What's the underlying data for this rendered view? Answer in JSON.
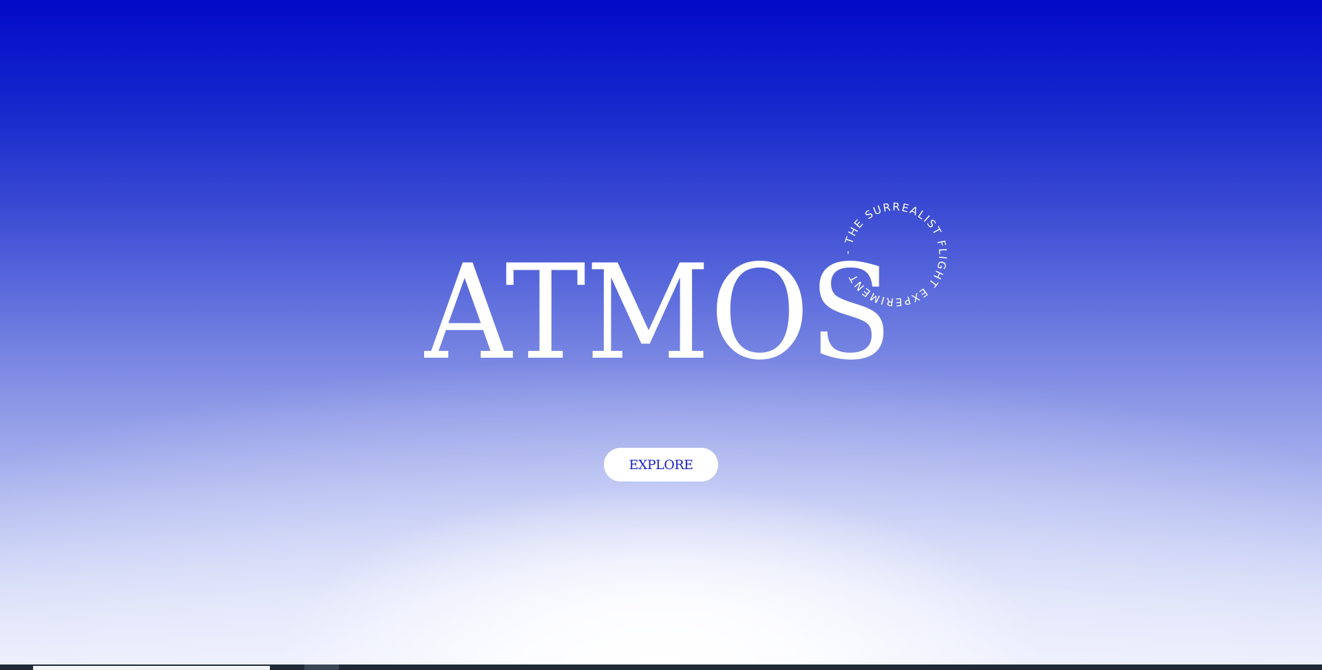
{
  "hero": {
    "title": "ATMOS",
    "tagline": "- THE SURREALIST FLIGHT EXPERIMENT ",
    "explore_label": "EXPLORE"
  },
  "colors": {
    "sky_top": "#0309c8",
    "sky_mid": "#5c6cdc",
    "sky_bottom": "#eceffc",
    "title_text": "#ffffff",
    "button_bg": "#ffffff",
    "button_text": "#1a22c4"
  },
  "taskbar": {
    "search_placeholder": ""
  }
}
